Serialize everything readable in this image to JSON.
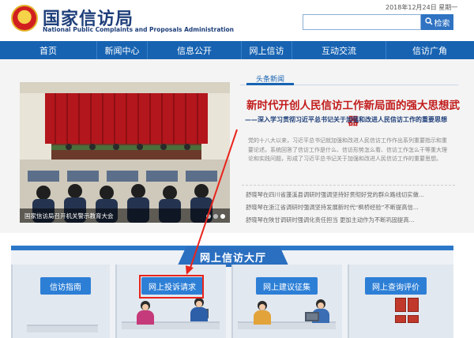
{
  "header": {
    "title_cn": "国家信访局",
    "title_en": "National Public Complaints and Proposals Administration",
    "date": "2018年12月24日 星期一",
    "search_placeholder": "",
    "search_button": "检索"
  },
  "nav": {
    "items": [
      "首页",
      "新闻中心",
      "信息公开",
      "网上信访",
      "互动交流",
      "信访广角"
    ]
  },
  "photo": {
    "caption": "国家信访局召开机关警示教育大会"
  },
  "news": {
    "tab": "头条新闻",
    "headline": "新时代开创人民信访工作新局面的强大思想武器",
    "subheadline": "——深入学习贯彻习近平总书记关于加强和改进人民信访工作的重要思想",
    "summary": "党的十八大以来，习近平总书记就加强和改进人民信访工作作出系列重要指示和重要论述。系统回答了信访工作是什么、信访形势怎么看、信访工作怎么干等重大理论和实践问题，形成了习近平总书记关于加强和改进人民信访工作的重要思想。",
    "items": [
      "舒晓琴在四川省蓬溪县调研时强调坚持好贯彻好党的群众路线切实做...",
      "舒晓琴在浙江省调研时强调坚持发展新时代“枫桥经验”不断提高信...",
      "舒晓琴在陕甘调研时强调化责任担当 更加主动作为不断巩固提高..."
    ]
  },
  "hall": {
    "title": "网上信访大厅",
    "entries": [
      "信访指南",
      "网上投诉请求",
      "网上建议征集",
      "网上查询评价"
    ]
  },
  "colors": {
    "nav_blue": "#1763b2",
    "headline_red": "#c21b1b",
    "highlight_red": "#e8241c"
  }
}
